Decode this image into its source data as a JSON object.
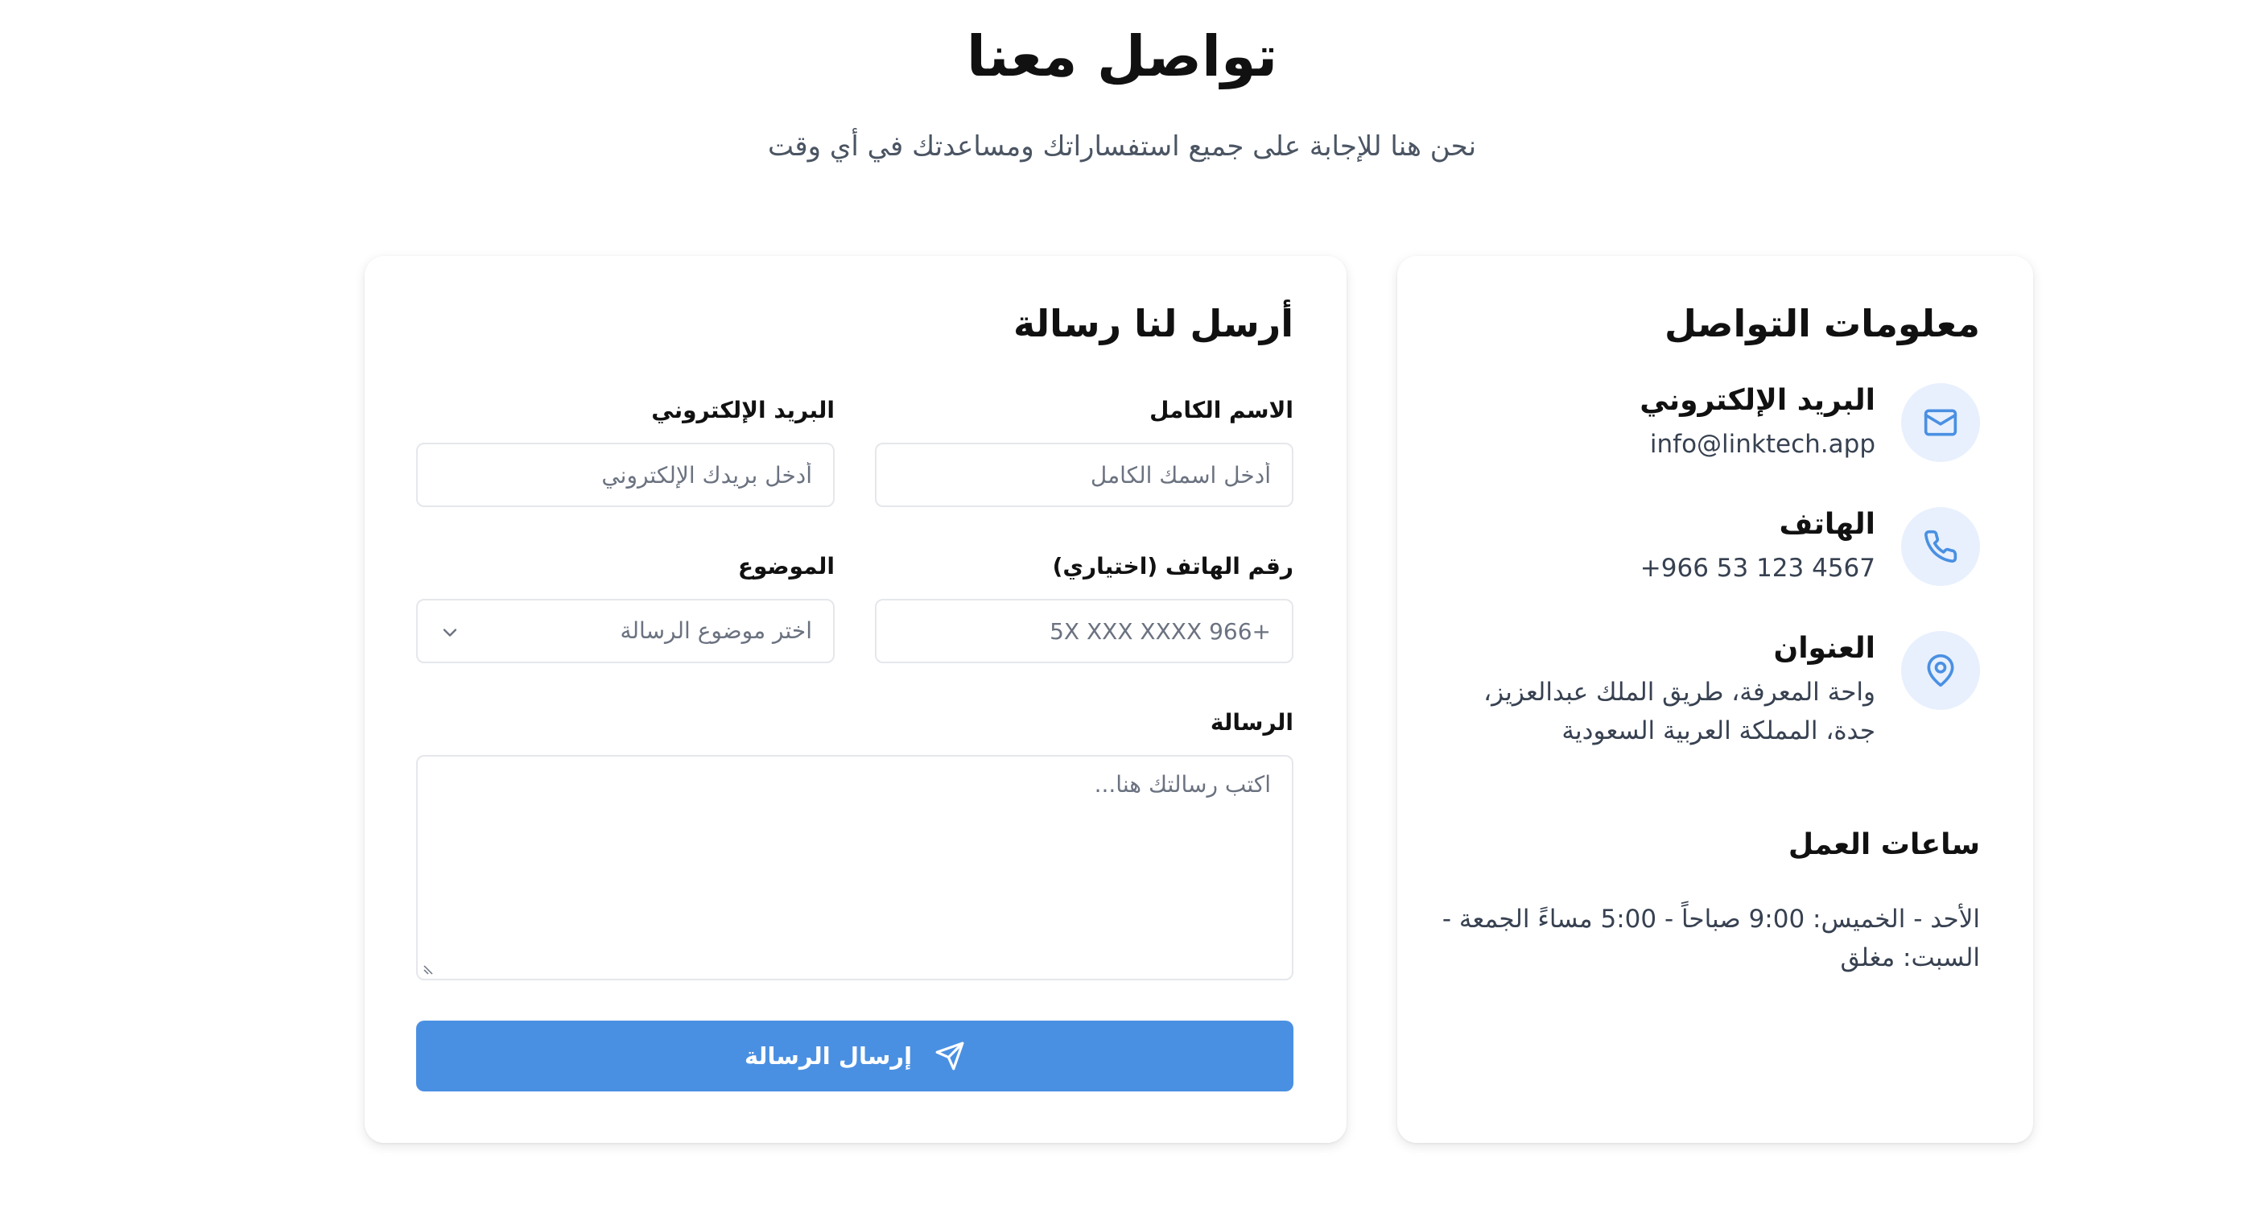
{
  "header": {
    "title": "تواصل معنا",
    "subtitle": "نحن هنا للإجابة على جميع استفساراتك ومساعدتك في أي وقت"
  },
  "contact_info": {
    "title": "معلومات التواصل",
    "items": [
      {
        "label": "البريد الإلكتروني",
        "value": "info@linktech.app",
        "icon": "mail-icon"
      },
      {
        "label": "الهاتف",
        "value": "+966 53 123 4567",
        "icon": "phone-icon"
      },
      {
        "label": "العنوان",
        "value": "واحة المعرفة، طريق الملك عبدالعزيز، جدة، المملكة العربية السعودية",
        "icon": "map-pin-icon"
      }
    ],
    "hours": {
      "title": "ساعات العمل",
      "text": "الأحد - الخميس: 9:00 صباحاً - 5:00 مساءً الجمعة - السبت: مغلق"
    }
  },
  "form": {
    "title": "أرسل لنا رسالة",
    "full_name": {
      "label": "الاسم الكامل",
      "placeholder": "أدخل اسمك الكامل"
    },
    "email": {
      "label": "البريد الإلكتروني",
      "placeholder": "أدخل بريدك الإلكتروني"
    },
    "phone": {
      "label": "رقم الهاتف (اختياري)",
      "placeholder": "+966 5X XXX XXXX"
    },
    "subject": {
      "label": "الموضوع",
      "selected": "اختر موضوع الرسالة"
    },
    "message": {
      "label": "الرسالة",
      "placeholder": "اكتب رسالتك هنا..."
    },
    "submit_label": "إرسال الرسالة"
  },
  "colors": {
    "accent": "#4a90e2",
    "icon_bg": "#e8f0fe",
    "border": "#e5e7eb",
    "muted_text": "#6b7280"
  }
}
